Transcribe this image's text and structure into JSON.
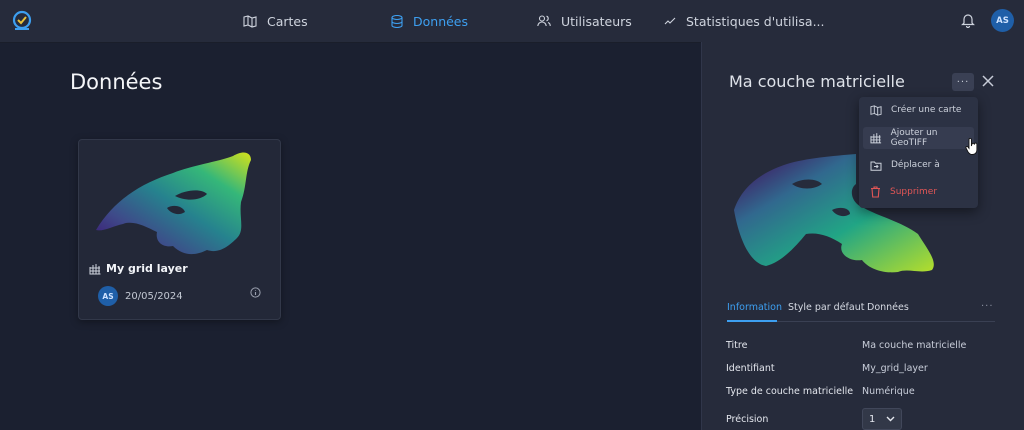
{
  "nav": {
    "items": [
      {
        "label": "Cartes",
        "icon": "map-icon",
        "active": false
      },
      {
        "label": "Données",
        "icon": "database-icon",
        "active": true
      },
      {
        "label": "Utilisateurs",
        "icon": "users-icon",
        "active": false
      },
      {
        "label": "Statistiques d'utilisa...",
        "icon": "chart-line-icon",
        "active": false
      }
    ],
    "avatar": "AS"
  },
  "page": {
    "title": "Données"
  },
  "card": {
    "name": "My grid layer",
    "avatar": "AS",
    "date": "20/05/2024"
  },
  "panel": {
    "title": "Ma couche matricielle",
    "more": "···",
    "menu": [
      {
        "label": "Créer une carte",
        "icon": "map-icon"
      },
      {
        "label": "Ajouter un GeoTIFF",
        "icon": "grid-icon"
      },
      {
        "label": "Déplacer à",
        "icon": "folder-move-icon"
      },
      {
        "label": "Supprimer",
        "icon": "trash-icon"
      }
    ],
    "tabs": [
      {
        "label": "Information",
        "active": true
      },
      {
        "label": "Style par défaut",
        "active": false
      },
      {
        "label": "Données",
        "active": false
      }
    ],
    "tabs_more": "···",
    "properties": [
      {
        "label": "Titre",
        "value": "Ma couche matricielle"
      },
      {
        "label": "Identifiant",
        "value": "My_grid_layer"
      },
      {
        "label": "Type de couche matricielle",
        "value": "Numérique"
      }
    ],
    "precision": {
      "label": "Précision",
      "value": "1"
    }
  },
  "colors": {
    "accent": "#3d9ff0",
    "danger": "#e25656",
    "background": "#1b2030",
    "panel": "#262b3b"
  }
}
